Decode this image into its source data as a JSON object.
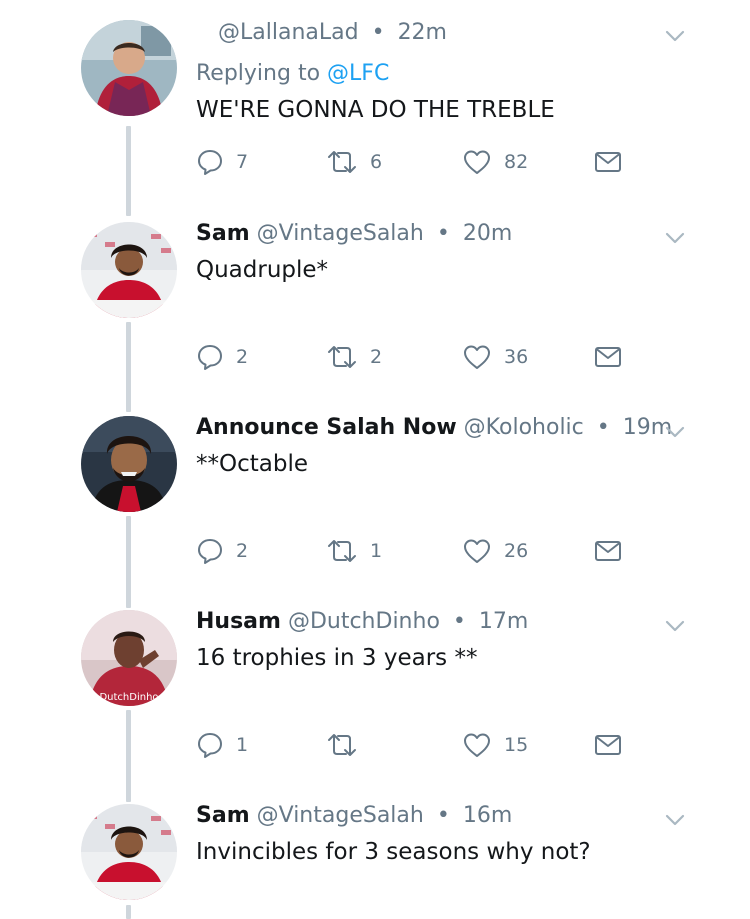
{
  "tweets": [
    {
      "display_name": "",
      "handle": "@LallanaLad",
      "time": "22m",
      "replying_label": "Replying to",
      "replying_to": "@LFC",
      "text": "WE'RE GONNA DO THE TREBLE",
      "replies": "7",
      "retweets": "6",
      "likes": "82",
      "avatar_color": "#2a7d9e"
    },
    {
      "display_name": "Sam",
      "handle": "@VintageSalah",
      "time": "20m",
      "text": "Quadruple*",
      "replies": "2",
      "retweets": "2",
      "likes": "36",
      "avatar_color": "#c8102e"
    },
    {
      "display_name": "Announce Salah Now",
      "handle": "@Koloholic",
      "time": "19m",
      "text": "**Octable",
      "replies": "2",
      "retweets": "1",
      "likes": "26",
      "avatar_color": "#1e2a38"
    },
    {
      "display_name": "Husam",
      "handle": "@DutchDinho",
      "time": "17m",
      "text": "16 trophies in 3 years **",
      "replies": "1",
      "retweets": "",
      "likes": "15",
      "avatar_color": "#b3263a",
      "avatar_watermark": "DutchDinho"
    },
    {
      "display_name": "Sam",
      "handle": "@VintageSalah",
      "time": "16m",
      "text": "Invincibles for 3 seasons why not?",
      "avatar_color": "#c8102e"
    }
  ],
  "separator": "•",
  "colors": {
    "text_primary": "#14171a",
    "text_secondary": "#657786",
    "link": "#1da1f2",
    "thread_line": "#cfd6dc"
  },
  "icons": [
    "reply-icon",
    "retweet-icon",
    "like-icon",
    "direct-message-icon",
    "caret-down-icon"
  ]
}
